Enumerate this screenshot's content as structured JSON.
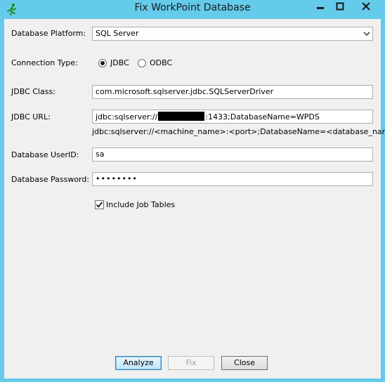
{
  "window": {
    "title": "Fix WorkPoint Database",
    "controls": {
      "minimize_icon": "minimize-icon",
      "maximize_icon": "maximize-icon",
      "close_icon": "close-icon"
    }
  },
  "form": {
    "platform": {
      "label": "Database Platform:",
      "value": "SQL Server"
    },
    "connection": {
      "label": "Connection Type:",
      "options": [
        "JDBC",
        "ODBC"
      ],
      "selected": "JDBC"
    },
    "jdbc_class": {
      "label": "JDBC Class:",
      "value": "com.microsoft.sqlserver.jdbc.SQLServerDriver"
    },
    "jdbc_url": {
      "label": "JDBC URL:",
      "value_prefix": "jdbc:sqlserver://",
      "value_suffix": ":1433;DatabaseName=WPDS",
      "hint": "jdbc:sqlserver://<machine_name>:<port>;DatabaseName=<database_name>"
    },
    "user_id": {
      "label": "Database UserID:",
      "value": "sa"
    },
    "password": {
      "label": "Database Password:",
      "value": "••••••••"
    },
    "include_job_tables": {
      "label": "Include Job Tables",
      "checked": true
    }
  },
  "buttons": {
    "analyze": "Analyze",
    "fix": "Fix",
    "close": "Close"
  },
  "colors": {
    "titlebar": "#65cbeb",
    "client": "#f0f0f0",
    "close_hover": "#c75050"
  }
}
